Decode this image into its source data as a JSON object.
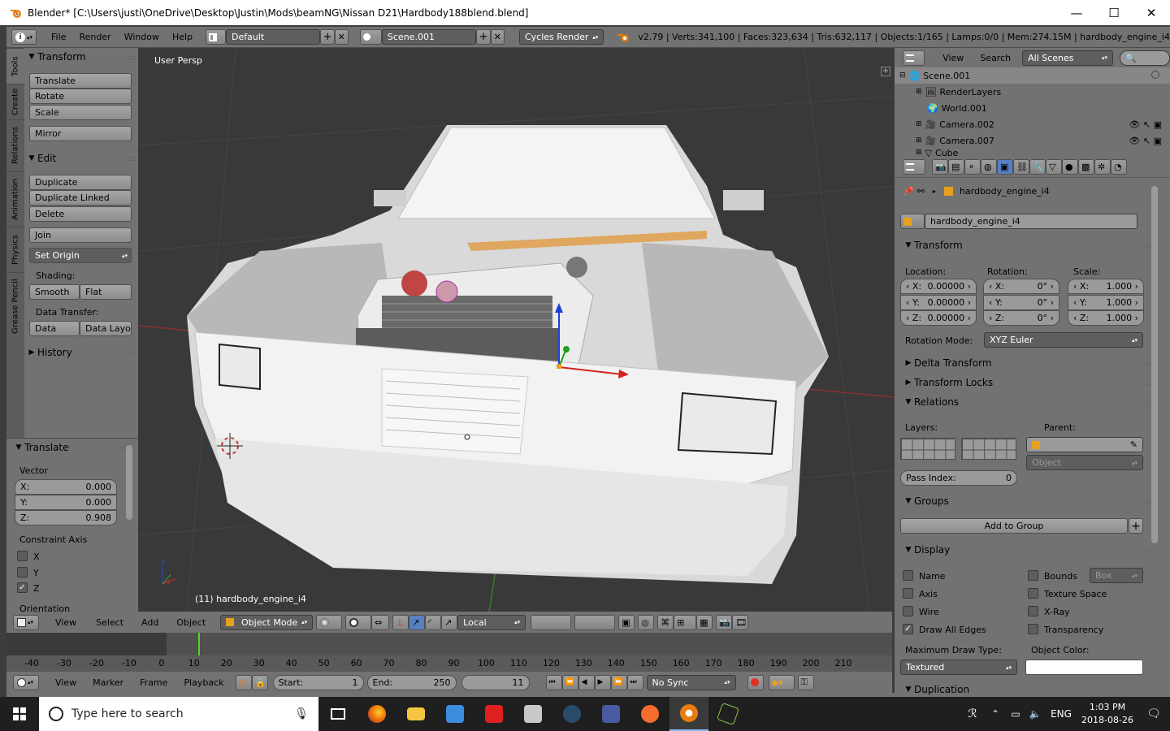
{
  "window": {
    "title": "Blender* [C:\\Users\\justi\\OneDrive\\Desktop\\Justin\\Mods\\beamNG\\Nissan D21\\Hardbody188blend.blend]",
    "minimize": "—",
    "maximize": "☐",
    "close": "✕"
  },
  "topbar": {
    "menus": [
      "File",
      "Render",
      "Window",
      "Help"
    ],
    "layout": "Default",
    "scene": "Scene.001",
    "engine": "Cycles Render",
    "stats": "v2.79 | Verts:341,100 | Faces:323,634 | Tris:632,117 | Objects:1/165 | Lamps:0/0 | Mem:274.15M | hardbody_engine_i4"
  },
  "tool_tabs": [
    "Tools",
    "Create",
    "Relations",
    "Animation",
    "Physics",
    "Grease Pencil"
  ],
  "toolshelf": {
    "transform_title": "Transform",
    "transform_buttons": [
      "Translate",
      "Rotate",
      "Scale"
    ],
    "mirror": "Mirror",
    "edit_title": "Edit",
    "edit_buttons": [
      "Duplicate",
      "Duplicate Linked",
      "Delete"
    ],
    "join": "Join",
    "set_origin": "Set Origin",
    "shading_label": "Shading:",
    "smooth": "Smooth",
    "flat": "Flat",
    "data_transfer_label": "Data Transfer:",
    "data": "Data",
    "data_layo": "Data Layo",
    "history": "History"
  },
  "operator": {
    "title": "Translate",
    "vector_label": "Vector",
    "x_label": "X:",
    "x": "0.000",
    "y_label": "Y:",
    "y": "0.000",
    "z_label": "Z:",
    "z": "0.908",
    "constraint_label": "Constraint Axis",
    "axes": [
      "X",
      "Y",
      "Z"
    ],
    "orientation_label": "Orientation"
  },
  "viewport": {
    "view_label": "User Persp",
    "object_label": "(11) hardbody_engine_i4"
  },
  "vp_header": {
    "menus": [
      "View",
      "Select",
      "Add",
      "Object"
    ],
    "mode": "Object Mode",
    "orientation": "Local"
  },
  "timeline": {
    "ticks": [
      "-40",
      "-30",
      "-20",
      "-10",
      "0",
      "10",
      "20",
      "30",
      "40",
      "50",
      "60",
      "70",
      "80",
      "90",
      "100",
      "110",
      "120",
      "130",
      "140",
      "150",
      "160",
      "170",
      "180",
      "190",
      "200",
      "210"
    ],
    "current_frame_marker": 11
  },
  "tl_header": {
    "menus": [
      "View",
      "Marker",
      "Frame",
      "Playback"
    ],
    "start_label": "Start:",
    "start": "1",
    "end_label": "End:",
    "end": "250",
    "current": "11",
    "sync": "No Sync"
  },
  "outliner": {
    "menus": [
      "View",
      "Search"
    ],
    "filter": "All Scenes",
    "rows": [
      "Scene.001",
      "RenderLayers",
      "World.001",
      "Camera.002",
      "Camera.007",
      "Cube"
    ]
  },
  "properties": {
    "object_path": "hardbody_engine_i4",
    "object_name": "hardbody_engine_i4",
    "transform_title": "Transform",
    "location_label": "Location:",
    "rotation_label": "Rotation:",
    "scale_label": "Scale:",
    "loc": [
      {
        "a": "X:",
        "v": "0.00000"
      },
      {
        "a": "Y:",
        "v": "0.00000"
      },
      {
        "a": "Z:",
        "v": "0.00000"
      }
    ],
    "rot": [
      {
        "a": "X:",
        "v": "0°"
      },
      {
        "a": "Y:",
        "v": "0°"
      },
      {
        "a": "Z:",
        "v": "0°"
      }
    ],
    "scl": [
      {
        "a": "X:",
        "v": "1.000"
      },
      {
        "a": "Y:",
        "v": "1.000"
      },
      {
        "a": "Z:",
        "v": "1.000"
      }
    ],
    "rotation_mode_label": "Rotation Mode:",
    "rotation_mode": "XYZ Euler",
    "delta_transform": "Delta Transform",
    "transform_locks": "Transform Locks",
    "relations_title": "Relations",
    "layers_label": "Layers:",
    "parent_label": "Parent:",
    "parent_type": "Object",
    "pass_index_label": "Pass Index:",
    "pass_index": "0",
    "groups_title": "Groups",
    "add_to_group": "Add to Group",
    "display_title": "Display",
    "display_left": [
      "Name",
      "Axis",
      "Wire",
      "Draw All Edges"
    ],
    "display_right": [
      "Bounds",
      "Texture Space",
      "X-Ray",
      "Transparency"
    ],
    "bounds_type": "Box",
    "max_draw_label": "Maximum Draw Type:",
    "max_draw": "Textured",
    "object_color_label": "Object Color:",
    "duplication": "Duplication"
  },
  "taskbar": {
    "search_placeholder": "Type here to search",
    "lang": "ENG",
    "time": "1:03 PM",
    "date": "2018-08-26"
  },
  "colors": {
    "accent_orange": "#e87d0d",
    "panel_bg": "#727272",
    "viewport_bg": "#393939"
  }
}
